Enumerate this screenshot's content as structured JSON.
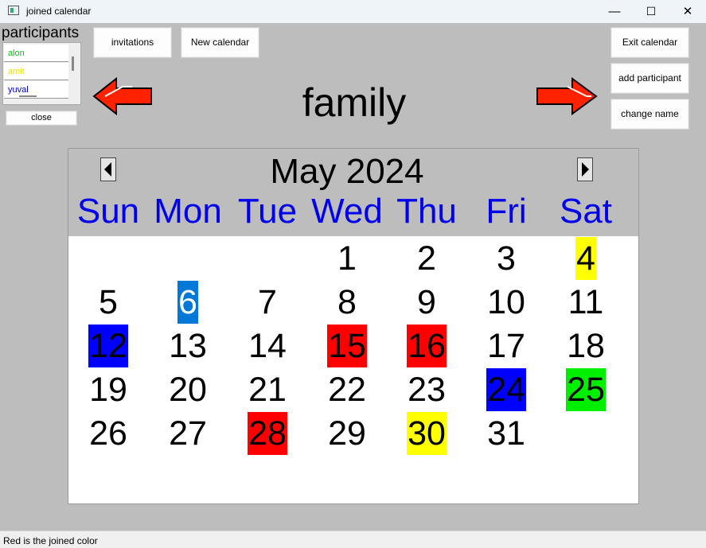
{
  "window": {
    "title": "joined calendar",
    "minimize": "—",
    "maximize": "☐",
    "close": "✕"
  },
  "toolbar": {
    "invitations_label": "invitations",
    "new_calendar_label": "New calendar",
    "exit_calendar_label": "Exit calendar",
    "add_participant_label": "add participant",
    "change_name_label": "change name"
  },
  "participants": {
    "title": "participants",
    "items": [
      {
        "name": "alon",
        "color": "#00cc00"
      },
      {
        "name": "amit",
        "color": "#e6e600"
      },
      {
        "name": "yuval",
        "color": "#0000cc"
      }
    ],
    "close_label": "close"
  },
  "calendar": {
    "name": "family",
    "month_label": "May 2024",
    "weekdays": [
      "Sun",
      "Mon",
      "Tue",
      "Wed",
      "Thu",
      "Fri",
      "Sat"
    ],
    "weeks": [
      [
        null,
        null,
        null,
        {
          "day": "1"
        },
        {
          "day": "2"
        },
        {
          "day": "3"
        },
        {
          "day": "4",
          "bg": "#ffff00"
        }
      ],
      [
        {
          "day": "5"
        },
        {
          "day": "6",
          "bg": "#0078d7",
          "fg": "#ffffff"
        },
        {
          "day": "7"
        },
        {
          "day": "8"
        },
        {
          "day": "9"
        },
        {
          "day": "10"
        },
        {
          "day": "11"
        }
      ],
      [
        {
          "day": "12",
          "bg": "#0000ff"
        },
        {
          "day": "13"
        },
        {
          "day": "14"
        },
        {
          "day": "15",
          "bg": "#ff0000"
        },
        {
          "day": "16",
          "bg": "#ff0000"
        },
        {
          "day": "17"
        },
        {
          "day": "18"
        }
      ],
      [
        {
          "day": "19"
        },
        {
          "day": "20"
        },
        {
          "day": "21"
        },
        {
          "day": "22"
        },
        {
          "day": "23"
        },
        {
          "day": "24",
          "bg": "#0000ff"
        },
        {
          "day": "25",
          "bg": "#00ee00"
        }
      ],
      [
        {
          "day": "26"
        },
        {
          "day": "27"
        },
        {
          "day": "28",
          "bg": "#ff0000"
        },
        {
          "day": "29"
        },
        {
          "day": "30",
          "bg": "#ffff00"
        },
        {
          "day": "31"
        },
        null
      ]
    ]
  },
  "status": {
    "text": "Red is the joined color"
  },
  "colors": {
    "background": "#bdbdbd",
    "weekday_text": "#0000ee",
    "arrow_fill": "#ff2200"
  },
  "icons": [
    "left-arrow-icon",
    "right-arrow-icon",
    "triangle-left-icon",
    "triangle-right-icon"
  ]
}
